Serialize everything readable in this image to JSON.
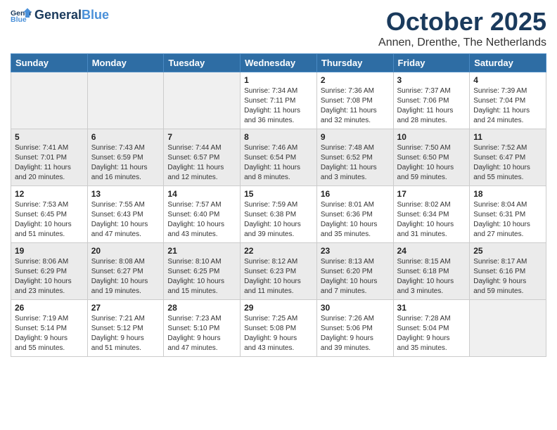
{
  "header": {
    "logo_line1": "General",
    "logo_line2": "Blue",
    "month": "October 2025",
    "location": "Annen, Drenthe, The Netherlands"
  },
  "weekdays": [
    "Sunday",
    "Monday",
    "Tuesday",
    "Wednesday",
    "Thursday",
    "Friday",
    "Saturday"
  ],
  "weeks": [
    [
      {
        "day": "",
        "info": ""
      },
      {
        "day": "",
        "info": ""
      },
      {
        "day": "",
        "info": ""
      },
      {
        "day": "1",
        "info": "Sunrise: 7:34 AM\nSunset: 7:11 PM\nDaylight: 11 hours\nand 36 minutes."
      },
      {
        "day": "2",
        "info": "Sunrise: 7:36 AM\nSunset: 7:08 PM\nDaylight: 11 hours\nand 32 minutes."
      },
      {
        "day": "3",
        "info": "Sunrise: 7:37 AM\nSunset: 7:06 PM\nDaylight: 11 hours\nand 28 minutes."
      },
      {
        "day": "4",
        "info": "Sunrise: 7:39 AM\nSunset: 7:04 PM\nDaylight: 11 hours\nand 24 minutes."
      }
    ],
    [
      {
        "day": "5",
        "info": "Sunrise: 7:41 AM\nSunset: 7:01 PM\nDaylight: 11 hours\nand 20 minutes."
      },
      {
        "day": "6",
        "info": "Sunrise: 7:43 AM\nSunset: 6:59 PM\nDaylight: 11 hours\nand 16 minutes."
      },
      {
        "day": "7",
        "info": "Sunrise: 7:44 AM\nSunset: 6:57 PM\nDaylight: 11 hours\nand 12 minutes."
      },
      {
        "day": "8",
        "info": "Sunrise: 7:46 AM\nSunset: 6:54 PM\nDaylight: 11 hours\nand 8 minutes."
      },
      {
        "day": "9",
        "info": "Sunrise: 7:48 AM\nSunset: 6:52 PM\nDaylight: 11 hours\nand 3 minutes."
      },
      {
        "day": "10",
        "info": "Sunrise: 7:50 AM\nSunset: 6:50 PM\nDaylight: 10 hours\nand 59 minutes."
      },
      {
        "day": "11",
        "info": "Sunrise: 7:52 AM\nSunset: 6:47 PM\nDaylight: 10 hours\nand 55 minutes."
      }
    ],
    [
      {
        "day": "12",
        "info": "Sunrise: 7:53 AM\nSunset: 6:45 PM\nDaylight: 10 hours\nand 51 minutes."
      },
      {
        "day": "13",
        "info": "Sunrise: 7:55 AM\nSunset: 6:43 PM\nDaylight: 10 hours\nand 47 minutes."
      },
      {
        "day": "14",
        "info": "Sunrise: 7:57 AM\nSunset: 6:40 PM\nDaylight: 10 hours\nand 43 minutes."
      },
      {
        "day": "15",
        "info": "Sunrise: 7:59 AM\nSunset: 6:38 PM\nDaylight: 10 hours\nand 39 minutes."
      },
      {
        "day": "16",
        "info": "Sunrise: 8:01 AM\nSunset: 6:36 PM\nDaylight: 10 hours\nand 35 minutes."
      },
      {
        "day": "17",
        "info": "Sunrise: 8:02 AM\nSunset: 6:34 PM\nDaylight: 10 hours\nand 31 minutes."
      },
      {
        "day": "18",
        "info": "Sunrise: 8:04 AM\nSunset: 6:31 PM\nDaylight: 10 hours\nand 27 minutes."
      }
    ],
    [
      {
        "day": "19",
        "info": "Sunrise: 8:06 AM\nSunset: 6:29 PM\nDaylight: 10 hours\nand 23 minutes."
      },
      {
        "day": "20",
        "info": "Sunrise: 8:08 AM\nSunset: 6:27 PM\nDaylight: 10 hours\nand 19 minutes."
      },
      {
        "day": "21",
        "info": "Sunrise: 8:10 AM\nSunset: 6:25 PM\nDaylight: 10 hours\nand 15 minutes."
      },
      {
        "day": "22",
        "info": "Sunrise: 8:12 AM\nSunset: 6:23 PM\nDaylight: 10 hours\nand 11 minutes."
      },
      {
        "day": "23",
        "info": "Sunrise: 8:13 AM\nSunset: 6:20 PM\nDaylight: 10 hours\nand 7 minutes."
      },
      {
        "day": "24",
        "info": "Sunrise: 8:15 AM\nSunset: 6:18 PM\nDaylight: 10 hours\nand 3 minutes."
      },
      {
        "day": "25",
        "info": "Sunrise: 8:17 AM\nSunset: 6:16 PM\nDaylight: 9 hours\nand 59 minutes."
      }
    ],
    [
      {
        "day": "26",
        "info": "Sunrise: 7:19 AM\nSunset: 5:14 PM\nDaylight: 9 hours\nand 55 minutes."
      },
      {
        "day": "27",
        "info": "Sunrise: 7:21 AM\nSunset: 5:12 PM\nDaylight: 9 hours\nand 51 minutes."
      },
      {
        "day": "28",
        "info": "Sunrise: 7:23 AM\nSunset: 5:10 PM\nDaylight: 9 hours\nand 47 minutes."
      },
      {
        "day": "29",
        "info": "Sunrise: 7:25 AM\nSunset: 5:08 PM\nDaylight: 9 hours\nand 43 minutes."
      },
      {
        "day": "30",
        "info": "Sunrise: 7:26 AM\nSunset: 5:06 PM\nDaylight: 9 hours\nand 39 minutes."
      },
      {
        "day": "31",
        "info": "Sunrise: 7:28 AM\nSunset: 5:04 PM\nDaylight: 9 hours\nand 35 minutes."
      },
      {
        "day": "",
        "info": ""
      }
    ]
  ]
}
